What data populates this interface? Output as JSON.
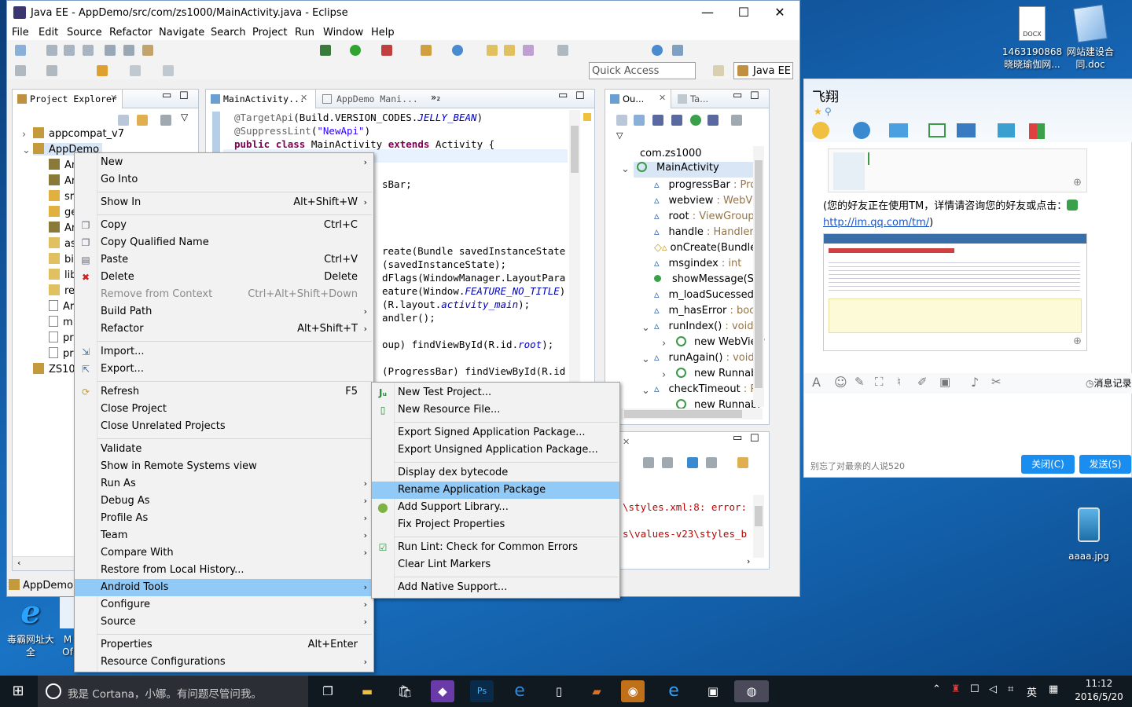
{
  "window": {
    "title": "Java EE - AppDemo/src/com/zs1000/MainActivity.java - Eclipse",
    "minimize": "—",
    "maximize": "☐",
    "close": "✕"
  },
  "menu": [
    "File",
    "Edit",
    "Source",
    "Refactor",
    "Navigate",
    "Search",
    "Project",
    "Run",
    "Window",
    "Help"
  ],
  "quick_access": {
    "placeholder": "Quick Access"
  },
  "perspective": {
    "label": "Java EE"
  },
  "project_explorer": {
    "tab": "Project Explorer",
    "items": [
      {
        "label": "appcompat_v7"
      },
      {
        "label": "AppDemo"
      },
      {
        "label": "Ar"
      },
      {
        "label": "Ar"
      },
      {
        "label": "sr"
      },
      {
        "label": "ge"
      },
      {
        "label": "Ar"
      },
      {
        "label": "as"
      },
      {
        "label": "bi"
      },
      {
        "label": "lib"
      },
      {
        "label": "re"
      },
      {
        "label": "Ar"
      },
      {
        "label": "m"
      },
      {
        "label": "pr"
      },
      {
        "label": "pr"
      },
      {
        "label": "ZS10"
      }
    ],
    "status": "AppDemo"
  },
  "editor": {
    "tabs": [
      {
        "label": "MainActivity..."
      },
      {
        "label": "AppDemo Mani..."
      },
      {
        "label": "»₂"
      }
    ],
    "lines": [
      {
        "a": "@TargetApi",
        "b": "(Build.VERSION_CODES.",
        "c": "JELLY_BEAN",
        "d": ")"
      },
      {
        "a": "@SuppressLint",
        "b": "(",
        "c": "\"NewApi\"",
        "d": ")"
      },
      {
        "k1": "public",
        "k2": "class",
        "n": " MainActivity ",
        "k3": "extends",
        "r": " Activity {"
      }
    ],
    "frag": [
      "sBar;",
      "reate(Bundle savedInstanceState",
      "(savedInstanceState);",
      "dFlags(WindowManager.LayoutPara",
      "eature(Window.",
      "(R.layout.",
      "andler();",
      "oup) findViewById(R.id.",
      "(ProgressBar) findViewById(R.id"
    ],
    "frag_italic": [
      "FEATURE_NO_TITLE",
      "activity_main",
      "root"
    ],
    "frag_tail": [
      ")",
      ");",
      ");"
    ]
  },
  "outline": {
    "tabs": [
      {
        "label": "Ou..."
      },
      {
        "label": "Ta..."
      }
    ],
    "items": [
      {
        "label": "com.zs1000"
      },
      {
        "label": "MainActivity"
      },
      {
        "label": "progressBar",
        "type": " : Pro"
      },
      {
        "label": "webview",
        "type": " : WebVi"
      },
      {
        "label": "root",
        "type": " : ViewGroup"
      },
      {
        "label": "handle",
        "type": " : Handler"
      },
      {
        "label": "onCreate(Bundle)",
        "type": ""
      },
      {
        "label": "msgindex",
        "type": " : int"
      },
      {
        "label": "showMessage(St",
        "type": ""
      },
      {
        "label": "m_loadSucessed",
        "type": ""
      },
      {
        "label": "m_hasError",
        "type": " : boo"
      },
      {
        "label": "runIndex()",
        "type": " : void"
      },
      {
        "label": "new WebView",
        "type": ""
      },
      {
        "label": "runAgain()",
        "type": " : void"
      },
      {
        "label": "new Runnabl",
        "type": ""
      },
      {
        "label": "checkTimeout",
        "type": " : R"
      },
      {
        "label": "new Runnabl",
        "type": ""
      }
    ]
  },
  "console": {
    "line1": "\\styles.xml:8: error:",
    "line2": "s\\values-v23\\styles_b"
  },
  "context_menu": {
    "items": [
      {
        "label": "New",
        "sc": "",
        "sub": true
      },
      {
        "label": "Go Into",
        "sc": ""
      },
      {
        "label": "Show In",
        "sc": "Alt+Shift+W",
        "sub": true
      },
      {
        "label": "Copy",
        "sc": "Ctrl+C"
      },
      {
        "label": "Copy Qualified Name",
        "sc": ""
      },
      {
        "label": "Paste",
        "sc": "Ctrl+V"
      },
      {
        "label": "Delete",
        "sc": "Delete"
      },
      {
        "label": "Remove from Context",
        "sc": "Ctrl+Alt+Shift+Down"
      },
      {
        "label": "Build Path",
        "sc": "",
        "sub": true
      },
      {
        "label": "Refactor",
        "sc": "Alt+Shift+T",
        "sub": true
      },
      {
        "label": "Import...",
        "sc": ""
      },
      {
        "label": "Export...",
        "sc": ""
      },
      {
        "label": "Refresh",
        "sc": "F5"
      },
      {
        "label": "Close Project",
        "sc": ""
      },
      {
        "label": "Close Unrelated Projects",
        "sc": ""
      },
      {
        "label": "Validate",
        "sc": ""
      },
      {
        "label": "Show in Remote Systems view",
        "sc": ""
      },
      {
        "label": "Run As",
        "sc": "",
        "sub": true
      },
      {
        "label": "Debug As",
        "sc": "",
        "sub": true
      },
      {
        "label": "Profile As",
        "sc": "",
        "sub": true
      },
      {
        "label": "Team",
        "sc": "",
        "sub": true
      },
      {
        "label": "Compare With",
        "sc": "",
        "sub": true
      },
      {
        "label": "Restore from Local History...",
        "sc": ""
      },
      {
        "label": "Android Tools",
        "sc": "",
        "sub": true
      },
      {
        "label": "Configure",
        "sc": "",
        "sub": true
      },
      {
        "label": "Source",
        "sc": "",
        "sub": true
      },
      {
        "label": "Properties",
        "sc": "Alt+Enter"
      },
      {
        "label": "Resource Configurations",
        "sc": "",
        "sub": true
      }
    ]
  },
  "submenu": {
    "items": [
      {
        "label": "New Test Project..."
      },
      {
        "label": "New Resource File..."
      },
      {
        "label": "Export Signed Application Package..."
      },
      {
        "label": "Export Unsigned Application Package..."
      },
      {
        "label": "Display dex bytecode"
      },
      {
        "label": "Rename Application Package"
      },
      {
        "label": "Add Support Library..."
      },
      {
        "label": "Fix Project Properties"
      },
      {
        "label": "Run Lint: Check for Common Errors"
      },
      {
        "label": "Clear Lint Markers"
      },
      {
        "label": "Add Native Support..."
      }
    ]
  },
  "qq": {
    "title": "飞翔",
    "notice": "(您的好友正在使用TM，详情请咨询您的好友或点击：",
    "link": "http://im.qq.com/tm/",
    "link_tail": ")",
    "history": "消息记录",
    "signature": "别忘了对最亲的人说520",
    "close_btn": "关闭(C)",
    "send_btn": "发送(S)"
  },
  "desktop_icons": [
    {
      "label": "1463190868\n晓晓瑜伽网..."
    },
    {
      "label": "网站建设合\n同.doc"
    },
    {
      "label": "aaaa.jpg"
    },
    {
      "label": "毒霸网址大\n全"
    },
    {
      "label": "M\nOf"
    }
  ],
  "taskbar": {
    "search": "我是 Cortana，小娜。有问题尽管问我。",
    "ime": "英",
    "time": "11:12",
    "date": "2016/5/20"
  }
}
